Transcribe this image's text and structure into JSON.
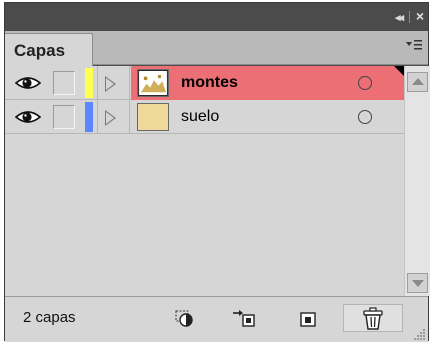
{
  "panel": {
    "tab_label": "Capas",
    "title_buttons": {
      "collapse": "◂◂",
      "close": "×"
    },
    "menu_icon": "panel-menu-icon"
  },
  "layers": [
    {
      "name": "montes",
      "color": "#ffff4d",
      "selected": true,
      "visible": true,
      "locked": false,
      "thumbnail": "montes-thumbnail"
    },
    {
      "name": "suelo",
      "color": "#5b86ff",
      "selected": false,
      "visible": true,
      "locked": false,
      "thumbnail": "suelo-thumbnail"
    }
  ],
  "colors": {
    "selected_row": "#ec6f76",
    "panel_bg": "#d6d6d6",
    "titlebar": "#4b4b4b",
    "suelo_thumb": "#f0d89a"
  },
  "footer": {
    "count_text": "2 capas",
    "icons": [
      "new-fill-icon",
      "anchor-icon",
      "new-layer-icon",
      "trash-icon"
    ]
  }
}
